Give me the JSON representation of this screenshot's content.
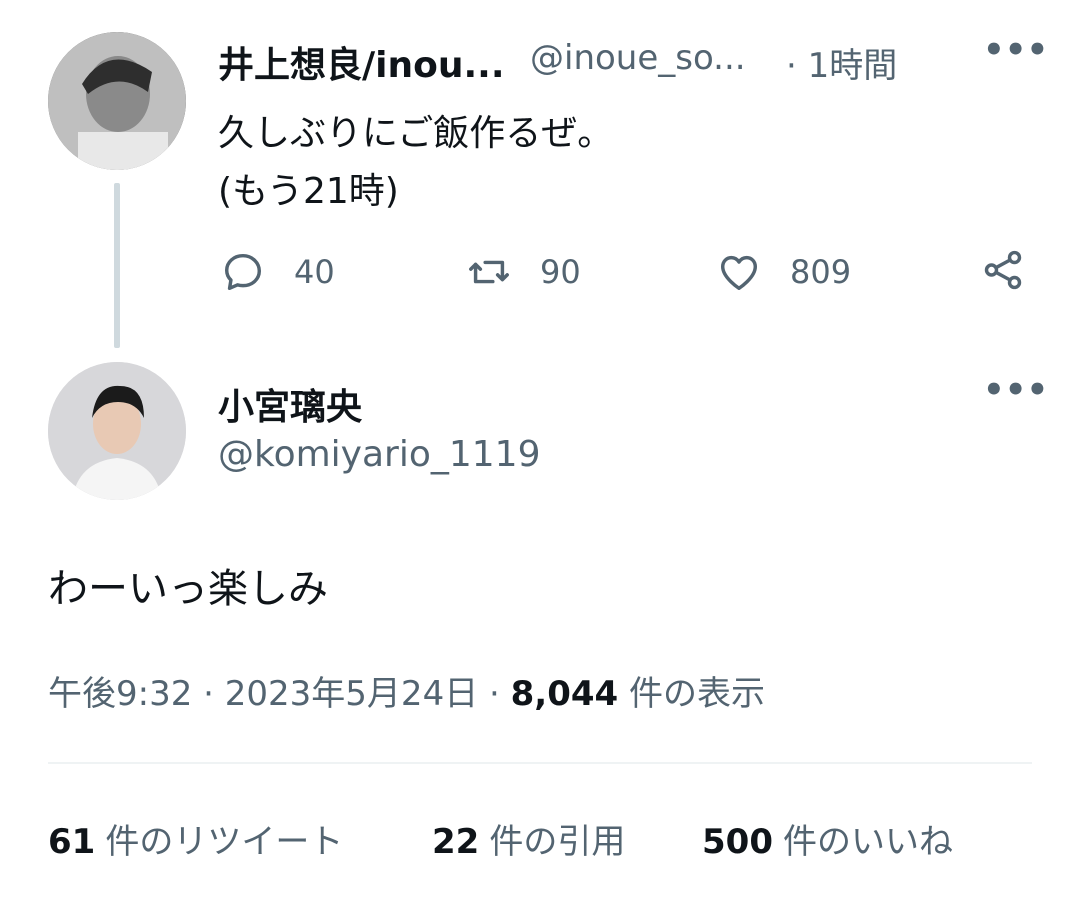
{
  "top_tweet": {
    "display_name": "井上想良/inou...",
    "handle": "@inoue_so...",
    "time": "· 1時間",
    "more": "•••",
    "lines": [
      "久しぶりにご飯作るぜ。",
      "(もう21時)"
    ],
    "actions": {
      "reply_count": "40",
      "retweet_count": "90",
      "like_count": "809"
    }
  },
  "reply_tweet": {
    "display_name": "小宮璃央",
    "handle": "@komiyario_1119",
    "more": "•••",
    "body": "わーいっ楽しみ",
    "timestamp": "午後9:32 · 2023年5月24日 · ",
    "views_count": "8,044",
    "views_label": " 件の表示"
  },
  "stats": {
    "retweets_count": "61",
    "retweets_label": "件のリツイート",
    "quotes_count": "22",
    "quotes_label": "件の引用",
    "likes_count": "500",
    "likes_label": "件のいいね"
  },
  "colors": {
    "text": "#0f1419",
    "secondary": "#536471",
    "thread_line": "#cfd9de",
    "divider": "#eff3f4"
  },
  "icons": [
    "reply-icon",
    "retweet-icon",
    "like-icon",
    "share-icon",
    "more-icon"
  ]
}
